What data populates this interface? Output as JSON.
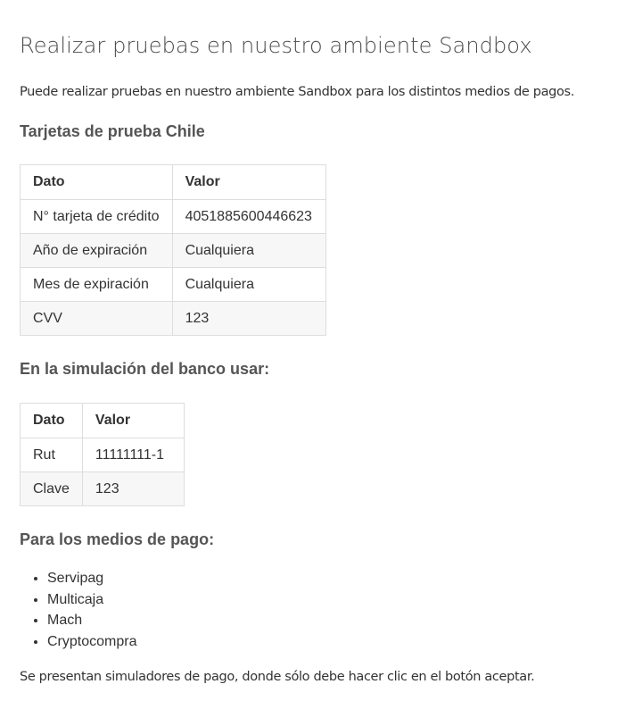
{
  "page": {
    "title": "Realizar pruebas en nuestro ambiente Sandbox",
    "intro": "Puede realizar pruebas en nuestro ambiente Sandbox para los distintos medios de pagos.",
    "outro": "Se presentan simuladores de pago, donde sólo debe hacer clic en el botón aceptar."
  },
  "cards_section": {
    "heading": "Tarjetas de prueba Chile",
    "headers": [
      "Dato",
      "Valor"
    ],
    "rows": [
      [
        "N° tarjeta de crédito",
        "4051885600446623"
      ],
      [
        "Año de expiración",
        "Cualquiera"
      ],
      [
        "Mes de expiración",
        "Cualquiera"
      ],
      [
        "CVV",
        "123"
      ]
    ]
  },
  "bank_section": {
    "heading": "En la simulación del banco usar:",
    "headers": [
      "Dato",
      "Valor"
    ],
    "rows": [
      [
        "Rut",
        "11111111-1"
      ],
      [
        "Clave",
        "123"
      ]
    ]
  },
  "methods_section": {
    "heading": "Para los medios de pago:",
    "items": [
      "Servipag",
      "Multicaja",
      "Mach",
      "Cryptocompra"
    ]
  }
}
